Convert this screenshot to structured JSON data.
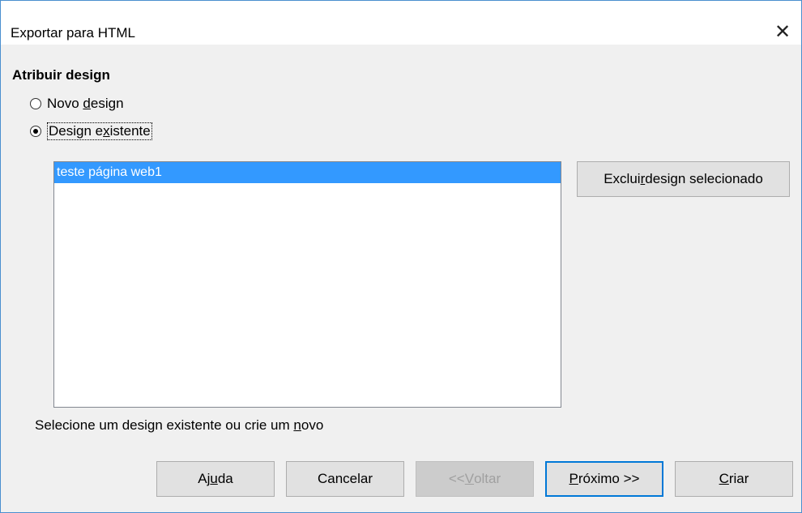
{
  "dialog": {
    "title": "Exportar para HTML",
    "close_icon": "close-icon"
  },
  "section": {
    "title": "Atribuir design"
  },
  "radios": {
    "new_design": {
      "pre": "Novo ",
      "acc": "d",
      "post": "esign",
      "checked": false
    },
    "existing_design": {
      "pre": "Design e",
      "acc": "x",
      "post": "istente",
      "checked": true
    }
  },
  "design_list": {
    "items": [
      {
        "label": "teste página web1",
        "selected": true
      }
    ]
  },
  "delete_button": {
    "pre": "Exclui",
    "acc": "r",
    "post": " design selecionado"
  },
  "hint": {
    "pre": "Selecione um design existente ou crie um ",
    "acc": "n",
    "post": "ovo"
  },
  "footer": {
    "help": {
      "pre": "Aj",
      "acc": "u",
      "post": "da"
    },
    "cancel": {
      "label": "Cancelar"
    },
    "back": {
      "pre": "<<",
      "acc": "V",
      "post": "oltar",
      "disabled": true
    },
    "next": {
      "pre": "",
      "acc": "P",
      "post": "róximo >>",
      "default": true
    },
    "create": {
      "pre": "",
      "acc": "C",
      "post": "riar"
    }
  }
}
